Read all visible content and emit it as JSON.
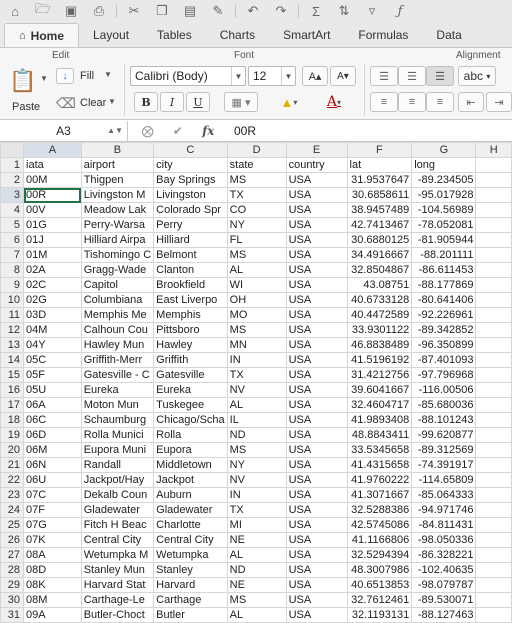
{
  "toolbar": {
    "icons": [
      "home-icon",
      "folder-open-icon",
      "save-icon",
      "print-icon",
      "cut-icon",
      "copy-icon",
      "paste-icon",
      "format-painter-icon",
      "undo-icon",
      "redo-icon",
      "autosum-icon",
      "sort-icon",
      "filter-icon",
      "function-icon"
    ]
  },
  "ribbon_tabs": [
    "Home",
    "Layout",
    "Tables",
    "Charts",
    "SmartArt",
    "Formulas",
    "Data"
  ],
  "ribbon": {
    "edit_label": "Edit",
    "font_label": "Font",
    "alignment_label": "Alignment",
    "paste_label": "Paste",
    "fill_label": "Fill",
    "clear_label": "Clear",
    "font_name": "Calibri (Body)",
    "font_size": "12",
    "bold": "B",
    "italic": "I",
    "underline": "U",
    "wrap_label": "abc"
  },
  "formula_bar": {
    "cell_ref": "A3",
    "fx_label": "fx",
    "value": "00R"
  },
  "columns": [
    "A",
    "B",
    "C",
    "D",
    "E",
    "F",
    "G",
    "H"
  ],
  "rows": [
    [
      "iata",
      "airport",
      "city",
      "state",
      "country",
      "lat",
      "long"
    ],
    [
      "00M",
      "Thigpen",
      "Bay Springs",
      "MS",
      "USA",
      "31.9537647",
      "-89.234505"
    ],
    [
      "00R",
      "Livingston M",
      "Livingston",
      "TX",
      "USA",
      "30.6858611",
      "-95.017928"
    ],
    [
      "00V",
      "Meadow Lak",
      "Colorado Spr",
      "CO",
      "USA",
      "38.9457489",
      "-104.56989"
    ],
    [
      "01G",
      "Perry-Warsa",
      "Perry",
      "NY",
      "USA",
      "42.7413467",
      "-78.052081"
    ],
    [
      "01J",
      "Hilliard Airpa",
      "Hilliard",
      "FL",
      "USA",
      "30.6880125",
      "-81.905944"
    ],
    [
      "01M",
      "Tishomingo C",
      "Belmont",
      "MS",
      "USA",
      "34.4916667",
      "-88.201111"
    ],
    [
      "02A",
      "Gragg-Wade",
      "Clanton",
      "AL",
      "USA",
      "32.8504867",
      "-86.611453"
    ],
    [
      "02C",
      "Capitol",
      "Brookfield",
      "WI",
      "USA",
      "43.08751",
      "-88.177869"
    ],
    [
      "02G",
      "Columbiana",
      "East Liverpo",
      "OH",
      "USA",
      "40.6733128",
      "-80.641406"
    ],
    [
      "03D",
      "Memphis Me",
      "Memphis",
      "MO",
      "USA",
      "40.4472589",
      "-92.226961"
    ],
    [
      "04M",
      "Calhoun Cou",
      "Pittsboro",
      "MS",
      "USA",
      "33.9301122",
      "-89.342852"
    ],
    [
      "04Y",
      "Hawley Mun",
      "Hawley",
      "MN",
      "USA",
      "46.8838489",
      "-96.350899"
    ],
    [
      "05C",
      "Griffith-Merr",
      "Griffith",
      "IN",
      "USA",
      "41.5196192",
      "-87.401093"
    ],
    [
      "05F",
      "Gatesville - C",
      "Gatesville",
      "TX",
      "USA",
      "31.4212756",
      "-97.796968"
    ],
    [
      "05U",
      "Eureka",
      "Eureka",
      "NV",
      "USA",
      "39.6041667",
      "-116.00506"
    ],
    [
      "06A",
      "Moton  Mun",
      "Tuskegee",
      "AL",
      "USA",
      "32.4604717",
      "-85.680036"
    ],
    [
      "06C",
      "Schaumburg",
      "Chicago/Scha",
      "IL",
      "USA",
      "41.9893408",
      "-88.101243"
    ],
    [
      "06D",
      "Rolla Munici",
      "Rolla",
      "ND",
      "USA",
      "48.8843411",
      "-99.620877"
    ],
    [
      "06M",
      "Eupora Muni",
      "Eupora",
      "MS",
      "USA",
      "33.5345658",
      "-89.312569"
    ],
    [
      "06N",
      "Randall",
      "Middletown",
      "NY",
      "USA",
      "41.4315658",
      "-74.391917"
    ],
    [
      "06U",
      "Jackpot/Hay",
      "Jackpot",
      "NV",
      "USA",
      "41.9760222",
      "-114.65809"
    ],
    [
      "07C",
      "Dekalb Coun",
      "Auburn",
      "IN",
      "USA",
      "41.3071667",
      "-85.064333"
    ],
    [
      "07F",
      "Gladewater",
      "Gladewater",
      "TX",
      "USA",
      "32.5288386",
      "-94.971746"
    ],
    [
      "07G",
      "Fitch H Beac",
      "Charlotte",
      "MI",
      "USA",
      "42.5745086",
      "-84.811431"
    ],
    [
      "07K",
      "Central City",
      "Central City",
      "NE",
      "USA",
      "41.1166806",
      "-98.050336"
    ],
    [
      "08A",
      "Wetumpka M",
      "Wetumpka",
      "AL",
      "USA",
      "32.5294394",
      "-86.328221"
    ],
    [
      "08D",
      "Stanley Mun",
      "Stanley",
      "ND",
      "USA",
      "48.3007986",
      "-102.40635"
    ],
    [
      "08K",
      "Harvard Stat",
      "Harvard",
      "NE",
      "USA",
      "40.6513853",
      "-98.079787"
    ],
    [
      "08M",
      "Carthage-Le",
      "Carthage",
      "MS",
      "USA",
      "32.7612461",
      "-89.530071"
    ],
    [
      "09A",
      "Butler-Choct",
      "Butler",
      "AL",
      "USA",
      "32.1193131",
      "-88.127463"
    ]
  ],
  "active_cell": "A3",
  "colors": {
    "selection": "#217346",
    "header_bg": "#efefef",
    "ribbon_bg": "#f6f6f6"
  }
}
